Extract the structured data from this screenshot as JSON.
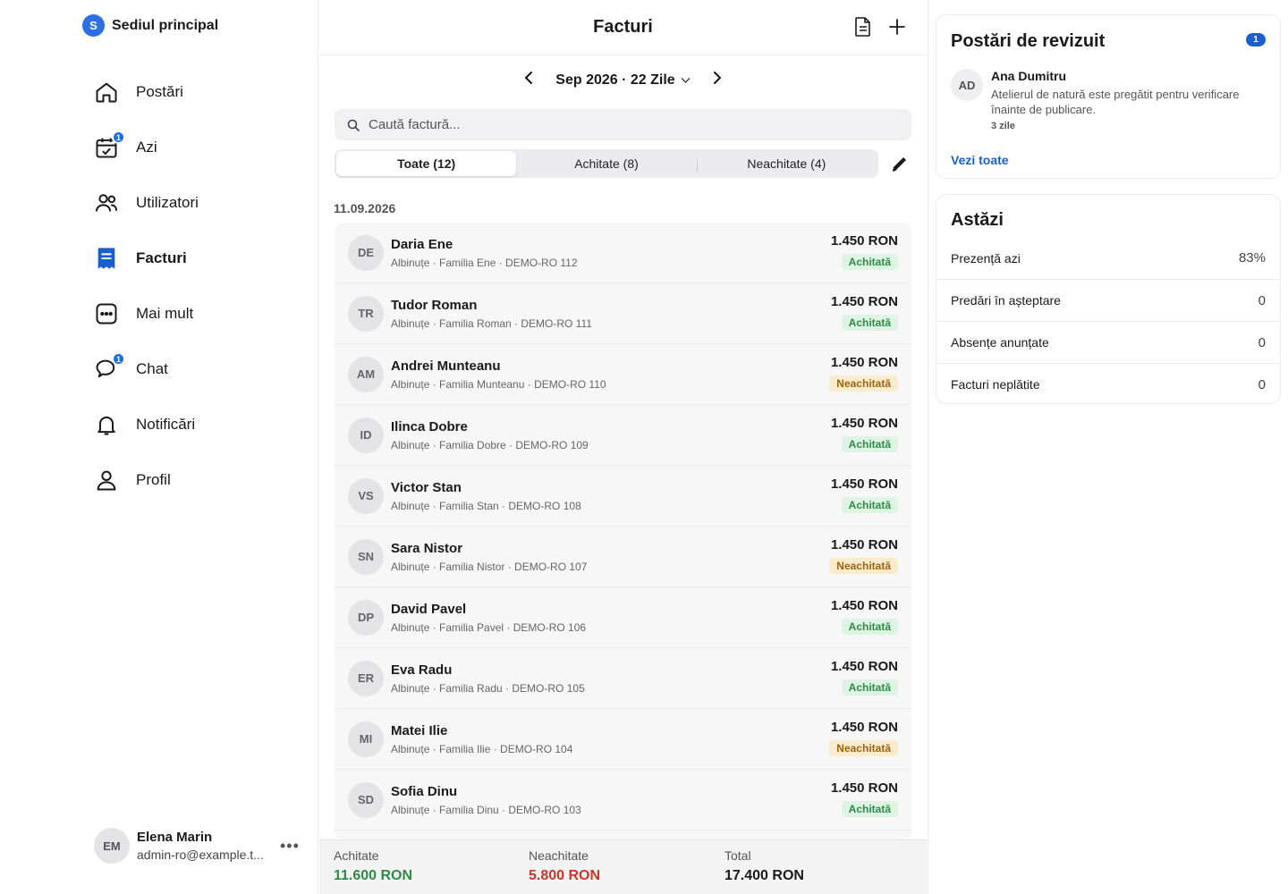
{
  "org": {
    "badge": "S",
    "name": "Sediul principal"
  },
  "sidebar": {
    "items": [
      {
        "label": "Postări",
        "icon": "home-icon",
        "badge": ""
      },
      {
        "label": "Azi",
        "icon": "calendar-check-icon",
        "badge": "1"
      },
      {
        "label": "Utilizatori",
        "icon": "users-icon",
        "badge": ""
      },
      {
        "label": "Facturi",
        "icon": "invoice-icon",
        "badge": ""
      },
      {
        "label": "Mai mult",
        "icon": "more-icon",
        "badge": ""
      },
      {
        "label": "Chat",
        "icon": "chat-icon",
        "badge": "1"
      },
      {
        "label": "Notificări",
        "icon": "bell-icon",
        "badge": ""
      },
      {
        "label": "Profil",
        "icon": "profile-icon",
        "badge": ""
      }
    ],
    "active": "Facturi"
  },
  "user": {
    "initials": "EM",
    "name": "Elena Marin",
    "email": "admin-ro@example.t..."
  },
  "main": {
    "title": "Facturi",
    "period": "Sep 2026 · 22 Zile",
    "search_placeholder": "Caută factură...",
    "tabs": [
      {
        "label": "Toate (12)",
        "active": true
      },
      {
        "label": "Achitate (8)",
        "active": false
      },
      {
        "label": "Neachitate (4)",
        "active": false
      }
    ],
    "date_header": "11.09.2026",
    "invoices": [
      {
        "initials": "DE",
        "name": "Daria Ene",
        "sub": "Albinuțe · Familia Ene · DEMO-RO 112",
        "amount": "1.450 RON",
        "status": "Achitată",
        "paid": true
      },
      {
        "initials": "TR",
        "name": "Tudor Roman",
        "sub": "Albinuțe · Familia Roman · DEMO-RO 111",
        "amount": "1.450 RON",
        "status": "Achitată",
        "paid": true
      },
      {
        "initials": "AM",
        "name": "Andrei Munteanu",
        "sub": "Albinuțe · Familia Munteanu · DEMO-RO 110",
        "amount": "1.450 RON",
        "status": "Neachitată",
        "paid": false
      },
      {
        "initials": "ID",
        "name": "Ilinca Dobre",
        "sub": "Albinuțe · Familia Dobre · DEMO-RO 109",
        "amount": "1.450 RON",
        "status": "Achitată",
        "paid": true
      },
      {
        "initials": "VS",
        "name": "Victor Stan",
        "sub": "Albinuțe · Familia Stan · DEMO-RO 108",
        "amount": "1.450 RON",
        "status": "Achitată",
        "paid": true
      },
      {
        "initials": "SN",
        "name": "Sara Nistor",
        "sub": "Albinuțe · Familia Nistor · DEMO-RO 107",
        "amount": "1.450 RON",
        "status": "Neachitată",
        "paid": false
      },
      {
        "initials": "DP",
        "name": "David Pavel",
        "sub": "Albinuțe · Familia Pavel · DEMO-RO 106",
        "amount": "1.450 RON",
        "status": "Achitată",
        "paid": true
      },
      {
        "initials": "ER",
        "name": "Eva Radu",
        "sub": "Albinuțe · Familia Radu · DEMO-RO 105",
        "amount": "1.450 RON",
        "status": "Achitată",
        "paid": true
      },
      {
        "initials": "MI",
        "name": "Matei Ilie",
        "sub": "Albinuțe · Familia Ilie · DEMO-RO 104",
        "amount": "1.450 RON",
        "status": "Neachitată",
        "paid": false
      },
      {
        "initials": "SD",
        "name": "Sofia Dinu",
        "sub": "Albinuțe · Familia Dinu · DEMO-RO 103",
        "amount": "1.450 RON",
        "status": "Achitată",
        "paid": true
      }
    ],
    "totals": {
      "paid_label": "Achitate",
      "paid_value": "11.600 RON",
      "unpaid_label": "Neachitate",
      "unpaid_value": "5.800 RON",
      "total_label": "Total",
      "total_value": "17.400 RON"
    }
  },
  "review": {
    "title": "Postări de revizuit",
    "badge": "1",
    "item": {
      "initials": "AD",
      "name": "Ana Dumitru",
      "text": "Atelierul de natură este pregătit pentru verificare înainte de publicare.",
      "time": "3 zile"
    },
    "see_all": "Vezi toate"
  },
  "today": {
    "title": "Astăzi",
    "stats": [
      {
        "label": "Prezență azi",
        "value": "83%"
      },
      {
        "label": "Predări în așteptare",
        "value": "0"
      },
      {
        "label": "Absențe anunțate",
        "value": "0"
      },
      {
        "label": "Facturi neplătite",
        "value": "0"
      }
    ]
  },
  "colors": {
    "accent": "#1a5fd0",
    "paid_green": "#2f8a45",
    "unpaid_red": "#c0392b",
    "paid_badge_bg": "#dff5e4",
    "unpaid_badge_bg": "#fbeccd"
  }
}
